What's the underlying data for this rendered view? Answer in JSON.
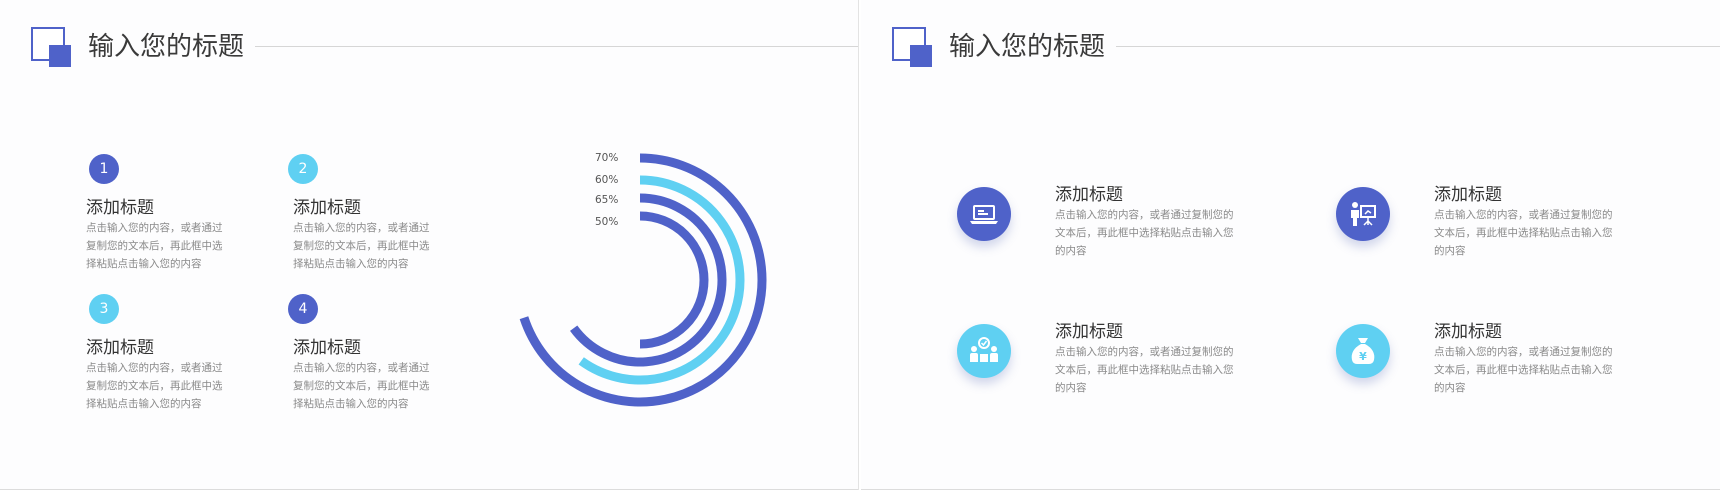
{
  "slide1": {
    "title": "输入您的标题",
    "items": [
      {
        "num": "1",
        "heading": "添加标题",
        "lines": [
          "点击输入您的内容，或者通过",
          "复制您的文本后，再此框中选",
          "择粘贴点击输入您的内容"
        ]
      },
      {
        "num": "2",
        "heading": "添加标题",
        "lines": [
          "点击输入您的内容，或者通过",
          "复制您的文本后，再此框中选",
          "择粘贴点击输入您的内容"
        ]
      },
      {
        "num": "3",
        "heading": "添加标题",
        "lines": [
          "点击输入您的内容，或者通过",
          "复制您的文本后，再此框中选",
          "择粘贴点击输入您的内容"
        ]
      },
      {
        "num": "4",
        "heading": "添加标题",
        "lines": [
          "点击输入您的内容，或者通过",
          "复制您的文本后，再此框中选",
          "择粘贴点击输入您的内容"
        ]
      }
    ],
    "chart_data": {
      "type": "radial-bar",
      "labels": [
        "70%",
        "60%",
        "65%",
        "50%"
      ],
      "values": [
        70,
        60,
        65,
        50
      ],
      "colors": [
        "#4f62c9",
        "#5fd0f2",
        "#4f62c9",
        "#4f62c9"
      ]
    }
  },
  "slide2": {
    "title": "输入您的标题",
    "items": [
      {
        "icon": "laptop-icon",
        "heading": "添加标题",
        "lines": [
          "点击输入您的内容，或者通过复制您的",
          "文本后，再此框中选择粘贴点击输入您",
          "的内容"
        ]
      },
      {
        "icon": "presentation-icon",
        "heading": "添加标题",
        "lines": [
          "点击输入您的内容，或者通过复制您的",
          "文本后，再此框中选择粘贴点击输入您",
          "的内容"
        ]
      },
      {
        "icon": "team-icon",
        "heading": "添加标题",
        "lines": [
          "点击输入您的内容，或者通过复制您的",
          "文本后，再此框中选择粘贴点击输入您",
          "的内容"
        ]
      },
      {
        "icon": "money-bag-icon",
        "heading": "添加标题",
        "lines": [
          "点击输入您的内容，或者通过复制您的",
          "文本后，再此框中选择粘贴点击输入您",
          "的内容"
        ]
      }
    ],
    "money_symbol": "¥",
    "colors": {
      "dark": "#4f62c9",
      "light": "#5fd0f2"
    }
  }
}
